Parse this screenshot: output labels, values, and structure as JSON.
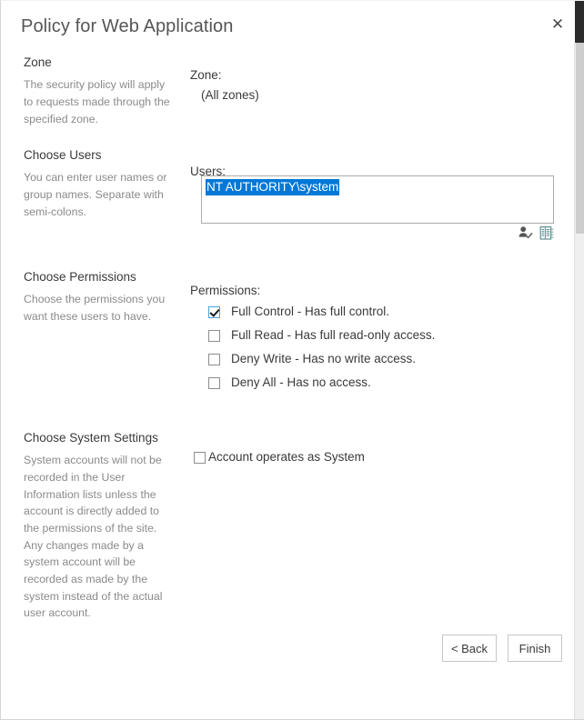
{
  "dialog": {
    "title": "Policy for Web Application",
    "close_label": "✕"
  },
  "sections": {
    "zone": {
      "side_title": "Zone",
      "side_desc": "The security policy will apply to requests made through the specified zone.",
      "field_label": "Zone:",
      "field_value": "(All zones)"
    },
    "users": {
      "side_title": "Choose Users",
      "side_desc": "You can enter user names or group names. Separate with semi-colons.",
      "field_label": "Users:",
      "value": "NT AUTHORITY\\system",
      "placeholder": "",
      "check_names_icon": "check-names-icon",
      "browse_icon": "address-book-icon"
    },
    "permissions": {
      "side_title": "Choose Permissions",
      "side_desc": "Choose the permissions you want these users to have.",
      "field_label": "Permissions:",
      "items": [
        {
          "label": "Full Control - Has full control.",
          "checked": true
        },
        {
          "label": "Full Read - Has full read-only access.",
          "checked": false
        },
        {
          "label": "Deny Write - Has no write access.",
          "checked": false
        },
        {
          "label": "Deny All - Has no access.",
          "checked": false
        }
      ]
    },
    "system": {
      "side_title": "Choose System Settings",
      "side_desc": "System accounts will not be recorded in the User Information lists unless the account is directly added to the permissions of the site. Any changes made by a system account will be recorded as made by the system instead of the actual user account.",
      "checkbox_label": "Account operates as System",
      "checked": false
    }
  },
  "footer": {
    "back_label": "< Back",
    "finish_label": "Finish"
  },
  "colors": {
    "selection_blue": "#0078d7",
    "title_gray": "#555555",
    "body_text": "#3a3a3a",
    "desc_gray": "#8a8a8a",
    "input_border": "#ababab",
    "button_border": "#c6c6c6"
  }
}
